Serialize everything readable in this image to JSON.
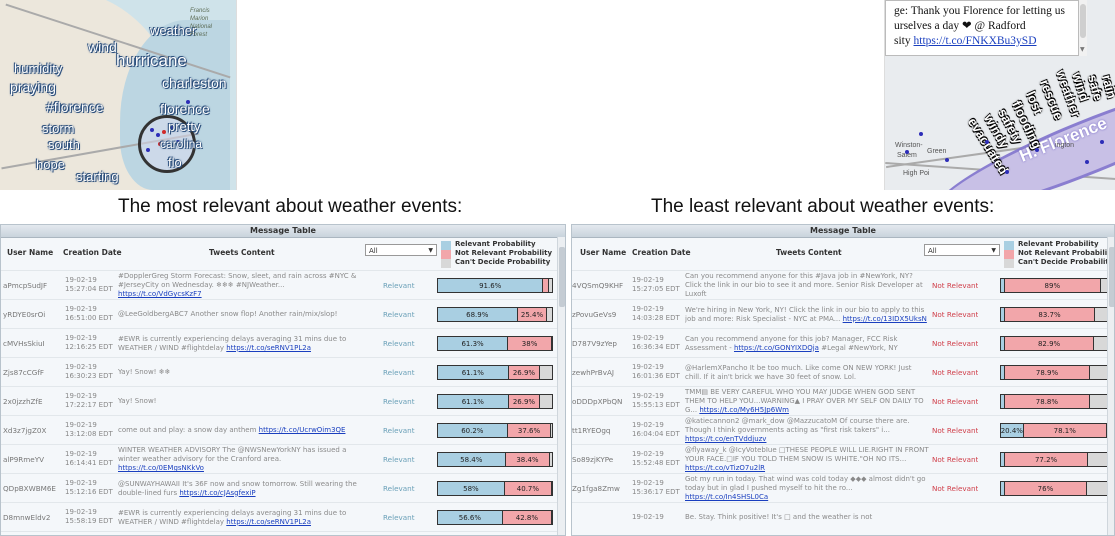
{
  "left_map": {
    "words": [
      {
        "text": "wind",
        "size": 14
      },
      {
        "text": "weather",
        "size": 13
      },
      {
        "text": "Francis",
        "size": 6
      },
      {
        "text": "Marion",
        "size": 6
      },
      {
        "text": "National",
        "size": 6
      },
      {
        "text": "Forest",
        "size": 6
      },
      {
        "text": "humidity",
        "size": 13
      },
      {
        "text": "hurricane",
        "size": 17
      },
      {
        "text": "praying",
        "size": 14
      },
      {
        "text": "charleston",
        "size": 14
      },
      {
        "text": "#florence",
        "size": 14
      },
      {
        "text": "florence",
        "size": 14
      },
      {
        "text": "storm",
        "size": 13
      },
      {
        "text": "pretty",
        "size": 13
      },
      {
        "text": "south",
        "size": 13
      },
      {
        "text": "carolina",
        "size": 12
      },
      {
        "text": "hope",
        "size": 13
      },
      {
        "text": "flo",
        "size": 13
      },
      {
        "text": "starting",
        "size": 13
      }
    ]
  },
  "right_map": {
    "tweet_lines": [
      "ge: Thank you Florence for letting us",
      "urselves a day ❤ @ Radford",
      "sity"
    ],
    "tweet_link": "https://t.co/FNKXBu3ySD",
    "words": [
      "rain",
      "safe",
      "wind",
      "weather",
      "rescue",
      "lost",
      "flooding",
      "safety",
      "windy",
      "evacuated"
    ],
    "band_label": "H. Florence",
    "places": [
      "Winston-",
      "Salem",
      "Green",
      "High Poi",
      "ington"
    ]
  },
  "captions": {
    "left": "The most relevant about weather events:",
    "right": "The least relevant about weather events:"
  },
  "left_table": {
    "title": "Message Table",
    "headers": {
      "user": "User Name",
      "date": "Creation Date",
      "tweet": "Tweets Content"
    },
    "filter": "All",
    "legend": [
      "Relevant Probability",
      "Not Relevant Probability",
      "Can't Decide Probability"
    ],
    "rows": [
      {
        "user": "aPmcpSudJF",
        "d1": "19-02-19",
        "d2": "15:27:04 EDT",
        "text": "#DopplerGreg Storm Forecast: Snow, sleet, and rain across #NYC & #JerseyCity on Wednesday. ❄❄❄ #NJWeather...",
        "link": "https://t.co/VdGycsKzF7",
        "label": "Relevant",
        "rel": 91.6,
        "rel_text": "91.6%",
        "not": 4.4,
        "not_text": ""
      },
      {
        "user": "yRDYE0srOi",
        "d1": "19-02-19",
        "d2": "16:51:00 EDT",
        "text": "@LeeGoldbergABC7 Another snow flop! Another rain/mix/slop!",
        "link": "",
        "label": "Relevant",
        "rel": 68.9,
        "rel_text": "68.9%",
        "not": 25.4,
        "not_text": "25.4%"
      },
      {
        "user": "cMVHsSkiuI",
        "d1": "19-02-19",
        "d2": "12:16:25 EDT",
        "text": "#EWR is currently experiencing delays averaging 31 mins due to WEATHER / WIND #flightdelay",
        "link": "https://t.co/seRNV1PL2a",
        "label": "Relevant",
        "rel": 61.3,
        "rel_text": "61.3%",
        "not": 38,
        "not_text": "38%"
      },
      {
        "user": "Zjs87cCGfF",
        "d1": "19-02-19",
        "d2": "16:30:23 EDT",
        "text": "Yay! Snow! ❄❄",
        "link": "",
        "label": "Relevant",
        "rel": 61.1,
        "rel_text": "61.1%",
        "not": 26.9,
        "not_text": "26.9%"
      },
      {
        "user": "2x0jzzhZfE",
        "d1": "19-02-19",
        "d2": "17:22:17 EDT",
        "text": "Yay! Snow!",
        "link": "",
        "label": "Relevant",
        "rel": 61.1,
        "rel_text": "61.1%",
        "not": 26.9,
        "not_text": "26.9%"
      },
      {
        "user": "Xd3z7jgZ0X",
        "d1": "19-02-19",
        "d2": "13:12:08 EDT",
        "text": "come out and play: a snow day anthem",
        "link": "https://t.co/UcrwOim3QE",
        "label": "Relevant",
        "rel": 60.2,
        "rel_text": "60.2%",
        "not": 37.6,
        "not_text": "37.6%"
      },
      {
        "user": "alP9RmeYV",
        "d1": "19-02-19",
        "d2": "16:14:41 EDT",
        "text": "WINTER WEATHER ADVISORY The @NWSNewYorkNY has issued a winter weather advisory for the Cranford area.",
        "link": "https://t.co/0EMgsNKkVo",
        "label": "Relevant",
        "rel": 58.4,
        "rel_text": "58.4%",
        "not": 38.4,
        "not_text": "38.4%"
      },
      {
        "user": "QDpBXWBM6E",
        "d1": "19-02-19",
        "d2": "15:12:16 EDT",
        "text": "@SUNWAYHAWAII It's 36F now and snow tomorrow. Still wearing the double-lined furs",
        "link": "https://t.co/cJAsgfexiP",
        "label": "Relevant",
        "rel": 58,
        "rel_text": "58%",
        "not": 40.7,
        "not_text": "40.7%"
      },
      {
        "user": "D8mnwEldv2",
        "d1": "19-02-19",
        "d2": "15:58:19 EDT",
        "text": "#EWR is currently experiencing delays averaging 31 mins due to WEATHER / WIND #flightdelay",
        "link": "https://t.co/seRNV1PL2a",
        "label": "Relevant",
        "rel": 56.6,
        "rel_text": "56.6%",
        "not": 42.8,
        "not_text": "42.8%"
      },
      {
        "user": "jnXpLnOYuR",
        "d1": "19-02-19",
        "d2": "13:21:12 EDT",
        "text": "Super Snow Moon tonight. ❄ Biggest and brightest of 2019. No wonder I've been feeling \"hinky\" as I call it, today...",
        "link": "https://t.co/RO7WyrW6S5",
        "label": "Relevant",
        "rel": 55.5,
        "rel_text": "55.5%",
        "not": 43.6,
        "not_text": "43.6%"
      }
    ]
  },
  "right_table": {
    "title": "Message Table",
    "headers": {
      "user": "User Name",
      "date": "Creation Date",
      "tweet": "Tweets Content"
    },
    "filter": "All",
    "legend": [
      "Relevant Probability",
      "Not Relevant Probability",
      "Can't Decide Probability"
    ],
    "rows": [
      {
        "user": "4VQSmQ9KHF",
        "d1": "19-02-19",
        "d2": "15:27:05 EDT",
        "text": "Can you recommend anyone for this #Java job in #NewYork, NY? Click the link in our bio to see it and more. Senior Risk Developer at Luxoft",
        "link": "",
        "label": "Not Relevant",
        "rel": 3,
        "rel_text": "",
        "not": 89,
        "not_text": "89%"
      },
      {
        "user": "zPovuGeVs9",
        "d1": "19-02-19",
        "d2": "14:03:28 EDT",
        "text": "We're hiring in New York, NY! Click the link in our bio to apply to this job and more: Risk Specialist - NYC at PMA...",
        "link": "https://t.co/13IDX5UksN",
        "label": "Not Relevant",
        "rel": 3,
        "rel_text": "",
        "not": 83.7,
        "not_text": "83.7%"
      },
      {
        "user": "D787V9zYep",
        "d1": "19-02-19",
        "d2": "16:36:34 EDT",
        "text": "Can you recommend anyone for this job? Manager, FCC Risk Assessment -",
        "link": "https://t.co/GONYIXDQja",
        "tail": "#Legal #NewYork, NY",
        "label": "Not Relevant",
        "rel": 3,
        "rel_text": "",
        "not": 82.9,
        "not_text": "82.9%"
      },
      {
        "user": "zewhPrBvAJ",
        "d1": "19-02-19",
        "d2": "16:01:36 EDT",
        "text": "@HarlemXPancho It be too much. Like come ON NEW YORK! Just chill. If it ain't brick we have 30 feet of snow. Lol.",
        "link": "",
        "label": "Not Relevant",
        "rel": 3,
        "rel_text": "",
        "not": 78.9,
        "not_text": "78.9%"
      },
      {
        "user": "oDDDpXPbQN",
        "d1": "19-02-19",
        "d2": "15:55:13 EDT",
        "text": "TMM▤ BE VERY CAREFUL WHO YOU MAY JUDGE WHEN GOD SENT THEM TO HELP YOU...WARNING▲ I PRAY OVER MY SELF ON DAILY TO G...",
        "link": "https://t.co/My6H5Jp6Wm",
        "label": "Not Relevant",
        "rel": 3,
        "rel_text": "",
        "not": 78.8,
        "not_text": "78.8%"
      },
      {
        "user": "tt1RYEOgq",
        "d1": "19-02-19",
        "d2": "16:04:04 EDT",
        "text": "@katiecannon2 @mark_dow @MazzucatoM Of course there are. Though I think governments acting as \"first risk takers\" i...",
        "link": "https://t.co/enTVddjuzv",
        "label": "Not Relevant",
        "rel": 20.4,
        "rel_text": "20.4%",
        "not": 78.1,
        "not_text": "78.1%"
      },
      {
        "user": "So89zjKYPe",
        "d1": "19-02-19",
        "d2": "15:52:48 EDT",
        "text": "@flyaway_k @IcyVotebIue □THESE PEOPLE WILL LIE.RIGHT IN FRONT YOUR FACE.□IF YOU TOLD THEM SNOW IS WHITE.\"OH NO ITS...",
        "link": "https://t.co/vTizO7u2lR",
        "label": "Not Relevant",
        "rel": 3,
        "rel_text": "",
        "not": 77.2,
        "not_text": "77.2%"
      },
      {
        "user": "Zg1fga8Zmw",
        "d1": "19-02-19",
        "d2": "15:36:17 EDT",
        "text": "Got my run in today. That wind was cold today ◆◆◆ almost didn't go today but in glad I pushed myself to hit the ro...",
        "link": "https://t.co/In4SHSL0Ca",
        "label": "Not Relevant",
        "rel": 3,
        "rel_text": "",
        "not": 76,
        "not_text": "76%"
      },
      {
        "user": "",
        "d1": "19-02-19",
        "d2": "",
        "text": "Be. Stay. Think positive! It's □ and the weather is not",
        "link": "",
        "label": "",
        "rel": 3,
        "rel_text": "",
        "not": 0,
        "not_text": ""
      }
    ]
  }
}
